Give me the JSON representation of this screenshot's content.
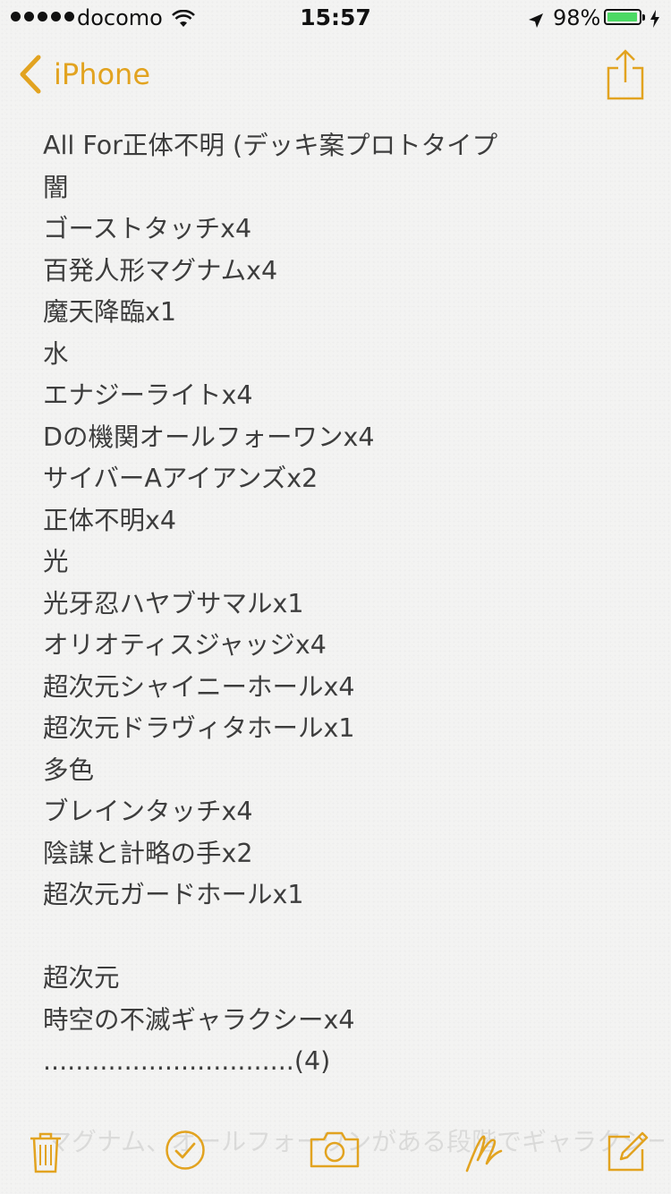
{
  "status_bar": {
    "carrier": "docomo",
    "time": "15:57",
    "battery_percent": "98%",
    "battery_level": 0.98
  },
  "nav": {
    "back_label": "iPhone",
    "back_icon": "chevron-left-icon",
    "share_icon": "share-icon"
  },
  "note": {
    "lines": [
      "All For正体不明 (デッキ案プロトタイプ",
      "闇",
      "ゴーストタッチx4",
      "百発人形マグナムx4",
      "魔天降臨x1",
      "水",
      "エナジーライトx4",
      "Dの機関オールフォーワンx4",
      "サイバーAアイアンズx2",
      "正体不明x4",
      "光",
      "光牙忍ハヤブサマルx1",
      "オリオティスジャッジx4",
      "超次元シャイニーホールx4",
      "超次元ドラヴィタホールx1",
      "多色",
      "ブレインタッチx4",
      "陰謀と計略の手x2",
      "超次元ガードホールx1",
      "",
      "超次元",
      "時空の不滅ギャラクシーx4",
      "...............................(4)"
    ],
    "overflow_text": "マグナム、オールフォーワンがある段階でギャラクシーを出す。"
  },
  "toolbar": {
    "icons": [
      "trash-icon",
      "checklist-icon",
      "camera-icon",
      "sketch-icon",
      "compose-icon"
    ]
  },
  "colors": {
    "accent": "#e2a320",
    "battery_green": "#4cd964",
    "text": "#3d3d3d",
    "paper": "#f3f3f2"
  }
}
